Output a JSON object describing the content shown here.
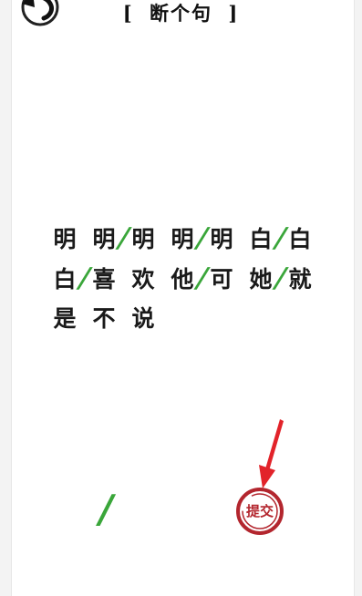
{
  "header": {
    "bracket_open": "[",
    "title": "断个句",
    "bracket_close": "]",
    "back_icon": "back-arrow-icon"
  },
  "sentence": {
    "lines": [
      [
        {
          "t": "char",
          "v": "明"
        },
        {
          "t": "gap"
        },
        {
          "t": "char",
          "v": "明"
        },
        {
          "t": "slash",
          "v": "/"
        },
        {
          "t": "char",
          "v": "明"
        },
        {
          "t": "gap"
        },
        {
          "t": "char",
          "v": "明"
        },
        {
          "t": "slash",
          "v": "/"
        },
        {
          "t": "char",
          "v": "明"
        },
        {
          "t": "gap"
        },
        {
          "t": "char",
          "v": "白"
        },
        {
          "t": "slash",
          "v": "/"
        },
        {
          "t": "char",
          "v": "白"
        }
      ],
      [
        {
          "t": "char",
          "v": "白"
        },
        {
          "t": "slash",
          "v": "/"
        },
        {
          "t": "char",
          "v": "喜"
        },
        {
          "t": "gap"
        },
        {
          "t": "char",
          "v": "欢"
        },
        {
          "t": "gap"
        },
        {
          "t": "char",
          "v": "他"
        },
        {
          "t": "slash",
          "v": "/"
        },
        {
          "t": "char",
          "v": "可"
        },
        {
          "t": "gap"
        },
        {
          "t": "char",
          "v": "她"
        },
        {
          "t": "slash",
          "v": "/"
        },
        {
          "t": "char",
          "v": "就"
        }
      ],
      [
        {
          "t": "char",
          "v": "是"
        },
        {
          "t": "gap"
        },
        {
          "t": "char",
          "v": "不"
        },
        {
          "t": "gap"
        },
        {
          "t": "char",
          "v": "说"
        }
      ]
    ]
  },
  "tools": {
    "slash_label": "/"
  },
  "submit": {
    "label": "提交"
  },
  "colors": {
    "slash": "#3aa63a",
    "submit": "#b3262e",
    "arrow": "#e2232a"
  }
}
